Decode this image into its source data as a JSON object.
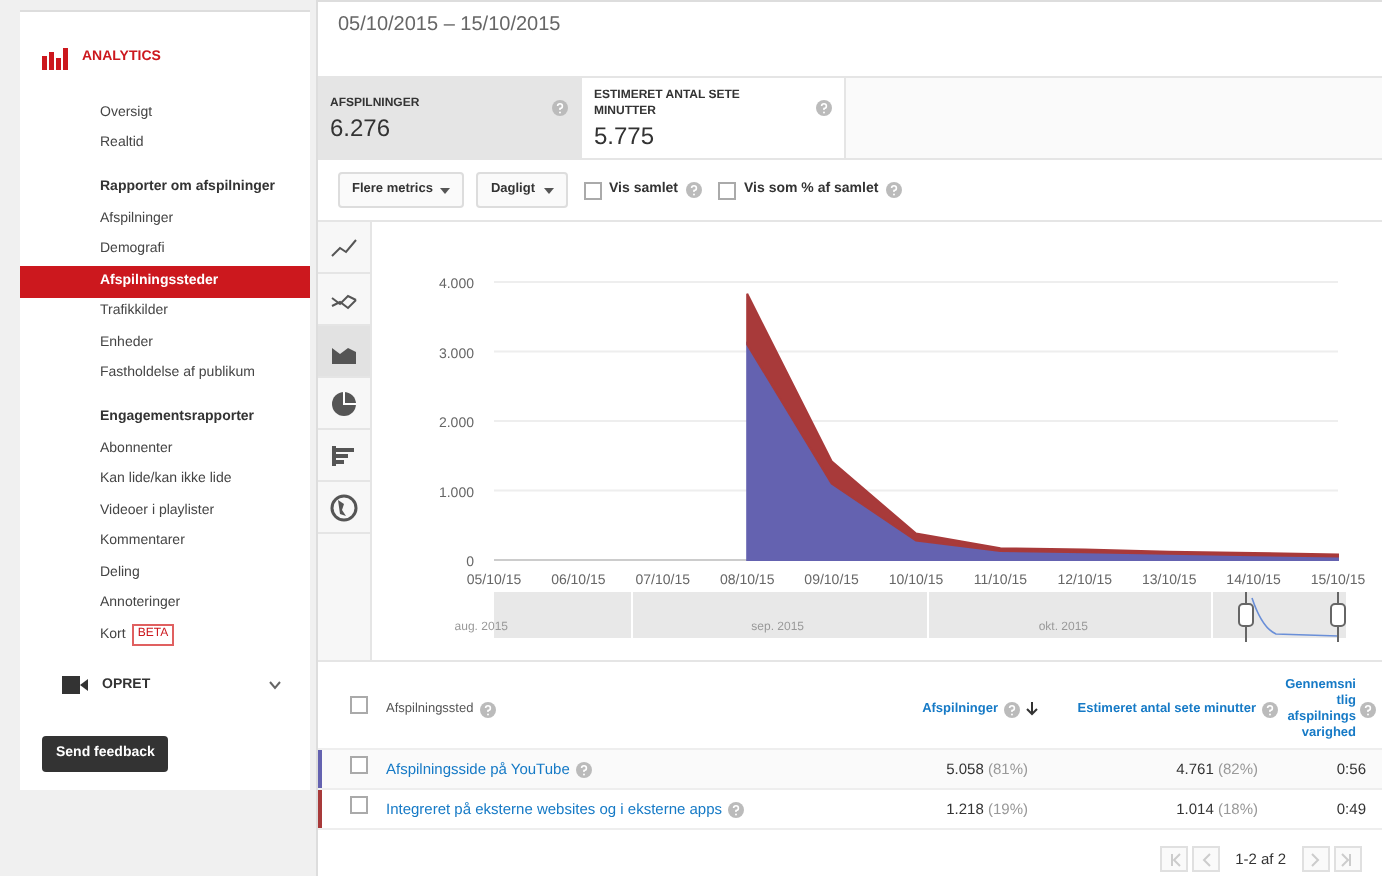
{
  "sidebar": {
    "title": "ANALYTICS",
    "groups": [
      {
        "items": [
          {
            "label": "Oversigt",
            "selected": false
          },
          {
            "label": "Realtid",
            "selected": false
          }
        ]
      },
      {
        "heading": "Rapporter om afspilninger",
        "items": [
          {
            "label": "Afspilninger",
            "selected": false
          },
          {
            "label": "Demografi",
            "selected": false
          },
          {
            "label": "Afspilningssteder",
            "selected": true
          },
          {
            "label": "Trafikkilder",
            "selected": false
          },
          {
            "label": "Enheder",
            "selected": false
          },
          {
            "label": "Fastholdelse af publikum",
            "selected": false
          }
        ]
      },
      {
        "heading": "Engagementsrapporter",
        "items": [
          {
            "label": "Abonnenter",
            "selected": false
          },
          {
            "label": "Kan lide/kan ikke lide",
            "selected": false
          },
          {
            "label": "Videoer i playlister",
            "selected": false
          },
          {
            "label": "Kommentarer",
            "selected": false
          },
          {
            "label": "Deling",
            "selected": false
          },
          {
            "label": "Annoteringer",
            "selected": false
          },
          {
            "label": "Kort",
            "selected": false,
            "badge": "BETA"
          }
        ]
      }
    ],
    "create": {
      "label": "OPRET",
      "expanded": false
    },
    "feedback": "Send feedback"
  },
  "date_range": "05/10/2015 – 15/10/2015",
  "metrics": [
    {
      "label": "AFSPILNINGER",
      "value": "6.276",
      "selected": true
    },
    {
      "label": "ESTIMERET ANTAL SETE MINUTTER",
      "value": "5.775",
      "selected": false
    }
  ],
  "controls": {
    "dropdowns": [
      "Flere metrics",
      "Dagligt"
    ],
    "checkboxes": [
      {
        "label": "Vis samlet",
        "checked": false
      },
      {
        "label": "Vis som % af samlet",
        "checked": false
      }
    ]
  },
  "chart_types": [
    {
      "kind": "line",
      "selected": false
    },
    {
      "kind": "compare",
      "selected": false
    },
    {
      "kind": "area",
      "selected": true
    },
    {
      "kind": "pie",
      "selected": false
    },
    {
      "kind": "bar",
      "selected": false
    },
    {
      "kind": "map",
      "selected": false
    }
  ],
  "chart_data": {
    "type": "area",
    "stacked": true,
    "grid": true,
    "categories": [
      "05/10/15",
      "06/10/15",
      "07/10/15",
      "08/10/15",
      "09/10/15",
      "10/10/15",
      "11/10/15",
      "12/10/15",
      "13/10/15",
      "14/10/15",
      "15/10/15"
    ],
    "yticks": [
      {
        "value": 0,
        "label": "0"
      },
      {
        "value": 1000,
        "label": "1.000"
      },
      {
        "value": 2000,
        "label": "2.000"
      },
      {
        "value": 3000,
        "label": "3.000"
      },
      {
        "value": 4000,
        "label": "4.000"
      }
    ],
    "ylim": [
      0,
      4000
    ],
    "series": [
      {
        "color": "#6462b0",
        "values": [
          null,
          null,
          null,
          3100,
          1100,
          280,
          130,
          110,
          90,
          70,
          50
        ]
      },
      {
        "color": "#a83a3a",
        "values": [
          null,
          null,
          null,
          730,
          320,
          100,
          40,
          40,
          30,
          30,
          30
        ]
      }
    ]
  },
  "navigator": {
    "months": [
      "aug. 2015",
      "sep. 2015",
      "okt. 2015"
    ]
  },
  "table": {
    "select_all_checked": false,
    "columns": [
      "Afspilningssted",
      "Afspilninger",
      "Estimeret antal sete minutter",
      "Gennemsnitlig afspilningsvarighed"
    ],
    "rows": [
      {
        "name": "Afspilningsside på YouTube",
        "color": "#6462b0",
        "checked": false,
        "views": "5.058",
        "views_pct": "(81%)",
        "minutes": "4.761",
        "minutes_pct": "(82%)",
        "duration": "0:56"
      },
      {
        "name": "Integreret på eksterne websites og i eksterne apps",
        "color": "#a83a3a",
        "checked": false,
        "views": "1.218",
        "views_pct": "(19%)",
        "minutes": "1.014",
        "minutes_pct": "(18%)",
        "duration": "0:49"
      }
    ]
  },
  "pagination": "1-2 af 2"
}
